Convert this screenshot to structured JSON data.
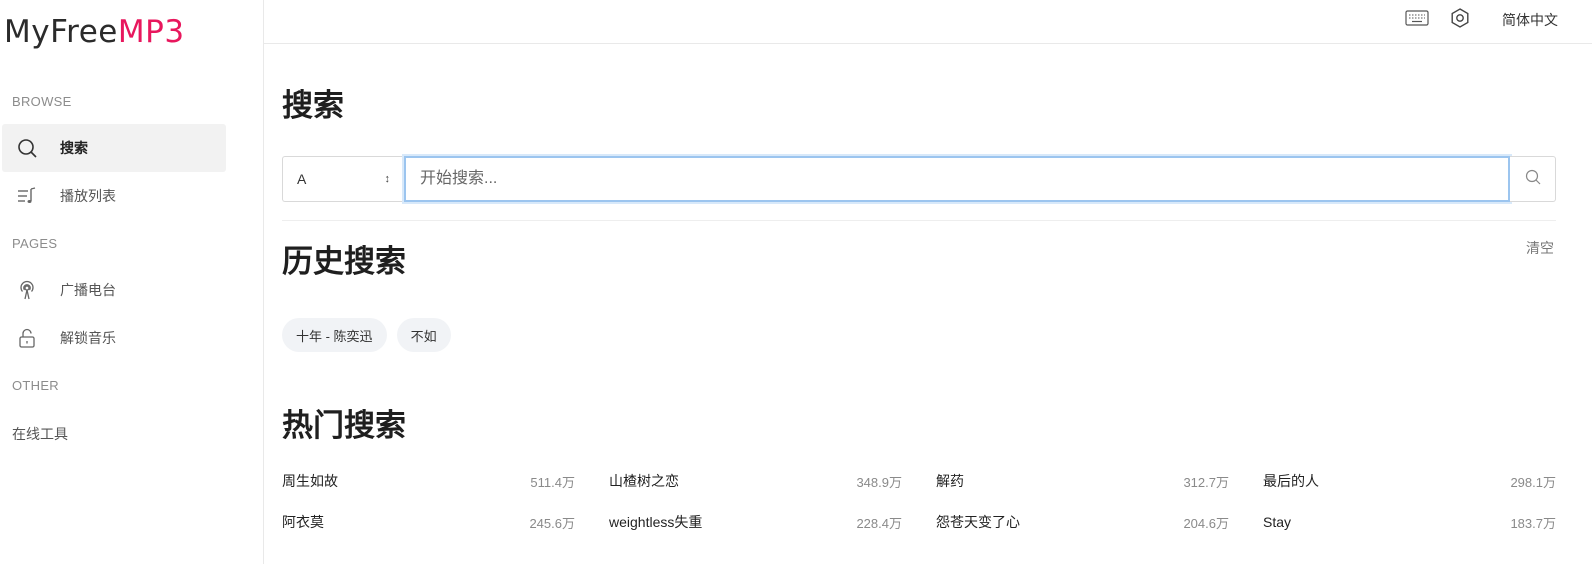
{
  "logo": {
    "part1": "MyFree",
    "part2": "MP3"
  },
  "sidebar": {
    "sections": {
      "browse": "BROWSE",
      "pages": "PAGES",
      "other": "OTHER"
    },
    "browse_items": [
      {
        "label": "搜索",
        "icon": "search-icon"
      },
      {
        "label": "播放列表",
        "icon": "playlist-icon"
      }
    ],
    "page_items": [
      {
        "label": "广播电台",
        "icon": "radio-icon"
      },
      {
        "label": "解锁音乐",
        "icon": "unlock-icon"
      }
    ],
    "other_items": [
      {
        "label": "在线工具"
      }
    ]
  },
  "topbar": {
    "language": "简体中文"
  },
  "main": {
    "title": "搜索",
    "search": {
      "source_value": "A",
      "placeholder": "开始搜索..."
    },
    "history": {
      "title": "历史搜索",
      "clear_label": "清空",
      "items": [
        "十年 - 陈奕迅",
        "不如"
      ]
    },
    "hot": {
      "title": "热门搜索",
      "items": [
        {
          "name": "周生如故",
          "count": "511.4万"
        },
        {
          "name": "山楂树之恋",
          "count": "348.9万"
        },
        {
          "name": "解药",
          "count": "312.7万"
        },
        {
          "name": "最后的人",
          "count": "298.1万"
        },
        {
          "name": "阿衣莫",
          "count": "245.6万"
        },
        {
          "name": "weightless失重",
          "count": "228.4万"
        },
        {
          "name": "怨苍天变了心",
          "count": "204.6万"
        },
        {
          "name": "Stay",
          "count": "183.7万"
        }
      ]
    }
  },
  "colors": {
    "brand": "#e8175d",
    "focus": "#9cc5ef"
  }
}
